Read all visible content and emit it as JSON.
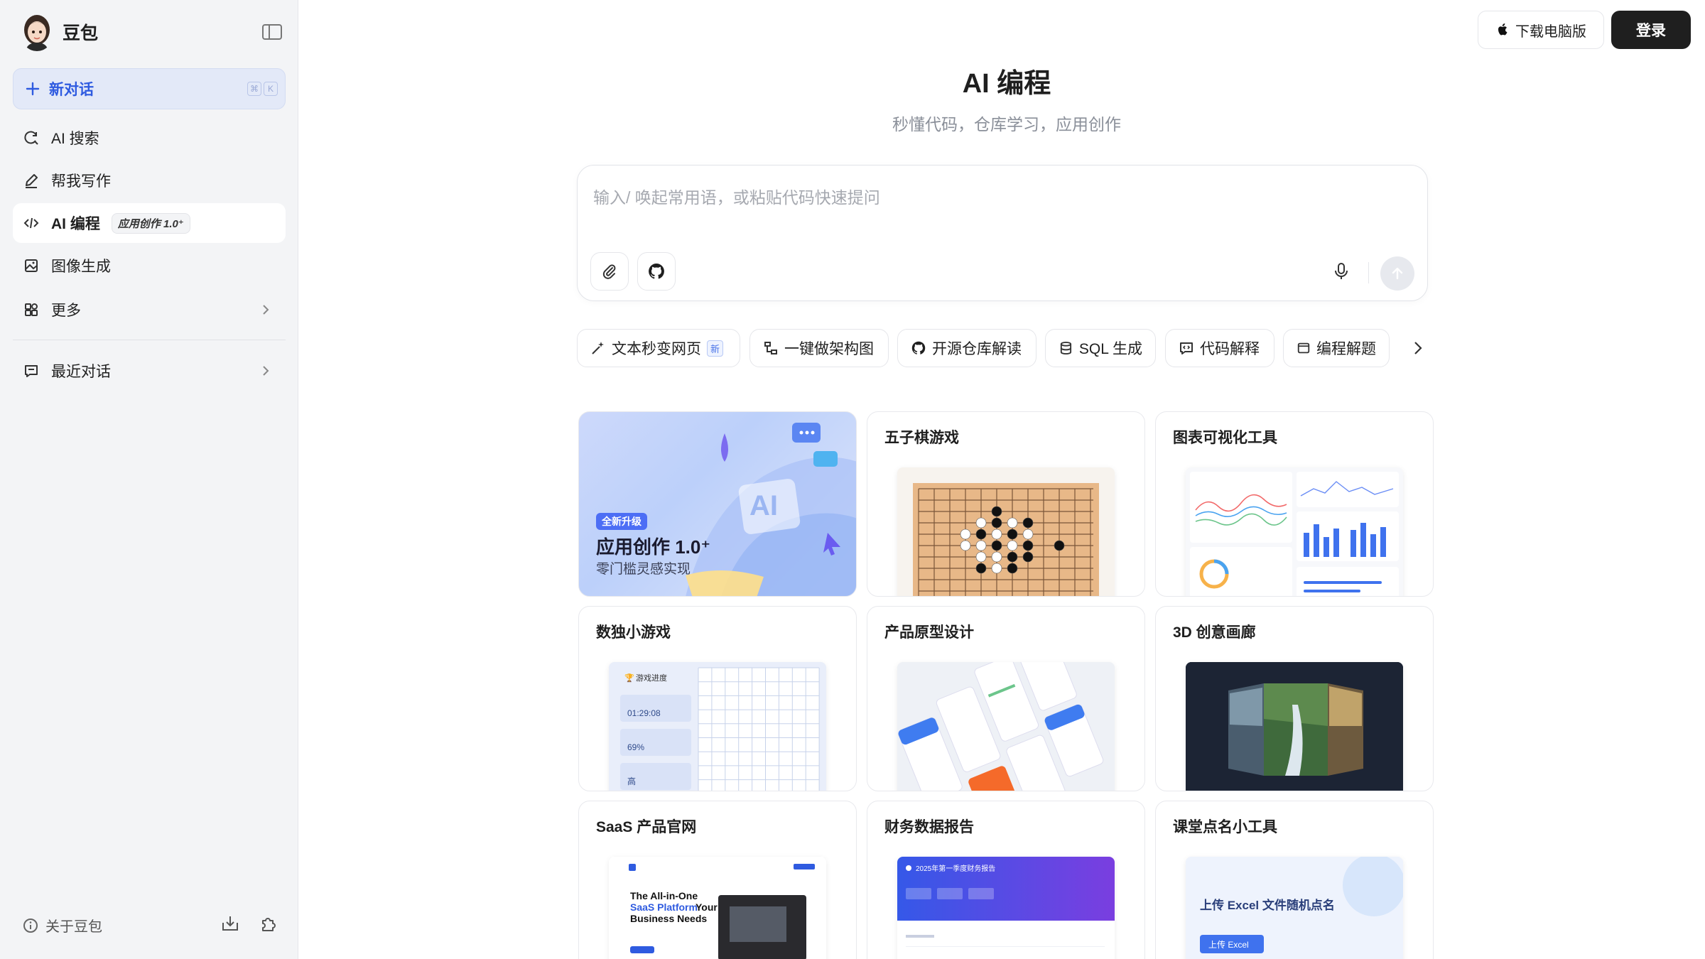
{
  "sidebar": {
    "brand_name": "豆包",
    "new_chat_label": "新对话",
    "shortcut_keys": [
      "⌘",
      "K"
    ],
    "items": [
      {
        "label": "AI 搜索",
        "icon": "search-refresh-icon"
      },
      {
        "label": "帮我写作",
        "icon": "pen-icon"
      },
      {
        "label": "AI 编程",
        "icon": "code-icon",
        "badge": "应用创作 1.0⁺",
        "active": true
      },
      {
        "label": "图像生成",
        "icon": "image-icon"
      },
      {
        "label": "更多",
        "icon": "grid-icon"
      }
    ],
    "recent_label": "最近对话",
    "about_label": "关于豆包"
  },
  "topbar": {
    "download_label": "下载电脑版",
    "login_label": "登录"
  },
  "main": {
    "title": "AI 编程",
    "subtitle": "秒懂代码，仓库学习，应用创作",
    "input_placeholder": "输入/ 唤起常用语，或粘贴代码快速提问"
  },
  "chips": [
    {
      "label": "文本秒变网页",
      "icon": "magic-wand-icon",
      "tag": "新"
    },
    {
      "label": "一键做架构图",
      "icon": "diagram-icon"
    },
    {
      "label": "开源仓库解读",
      "icon": "github-icon"
    },
    {
      "label": "SQL 生成",
      "icon": "database-icon"
    },
    {
      "label": "代码解释",
      "icon": "code-comment-icon"
    },
    {
      "label": "编程解题",
      "icon": "window-icon"
    }
  ],
  "hero_card": {
    "badge": "全新升级",
    "title": "应用创作 1.0⁺",
    "subtitle": "零门槛灵感实现",
    "art_text": "AI"
  },
  "cards": [
    {
      "title": "五子棋游戏"
    },
    {
      "title": "图表可视化工具"
    },
    {
      "title": "数独小游戏"
    },
    {
      "title": "产品原型设计"
    },
    {
      "title": "3D 创意画廊"
    },
    {
      "title": "SaaS 产品官网"
    },
    {
      "title": "财务数据报告"
    },
    {
      "title": "课堂点名小工具"
    }
  ],
  "thumb_text": {
    "sudoku_header": "游戏进度",
    "sudoku_time": "01:29:08",
    "sudoku_pct": "69%",
    "sudoku_level": "高",
    "saas_line1": "The All-in-One",
    "saas_line2": "SaaS Platform",
    "saas_line2b": "Your",
    "saas_line3": "Business Needs",
    "finance_header": "2025年第一季度财务报告",
    "excel_title": "上传 Excel 文件随机点名",
    "excel_button": "上传 Excel"
  },
  "colors": {
    "accent": "#2f5be0",
    "sidebar_bg": "#f3f4f6",
    "login_bg": "#1f1f1f"
  }
}
